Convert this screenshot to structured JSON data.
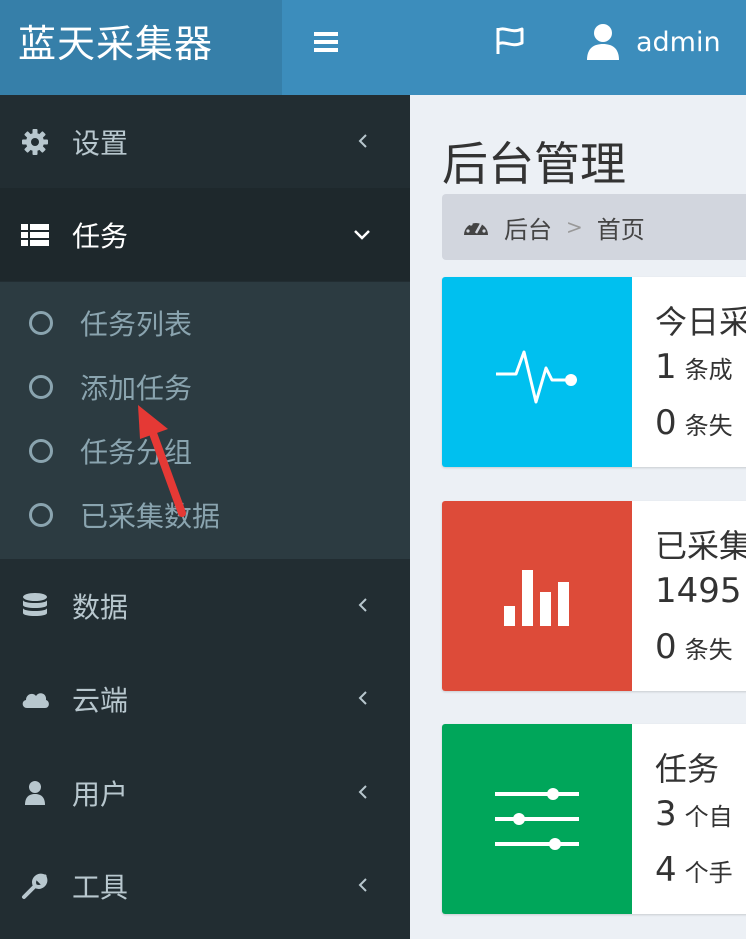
{
  "header": {
    "logo": "蓝天采集器",
    "username": "admin",
    "colors": {
      "bar": "#3c8dbc",
      "logo_bg": "#367fa9"
    }
  },
  "sidebar": {
    "items": [
      {
        "label": "设置",
        "icon": "gear-icon",
        "state": "collapsed"
      },
      {
        "label": "任务",
        "icon": "list-icon",
        "state": "expanded"
      },
      {
        "label": "数据",
        "icon": "database-icon",
        "state": "collapsed"
      },
      {
        "label": "云端",
        "icon": "cloud-icon",
        "state": "collapsed"
      },
      {
        "label": "用户",
        "icon": "user-icon",
        "state": "collapsed"
      },
      {
        "label": "工具",
        "icon": "wrench-icon",
        "state": "collapsed"
      }
    ],
    "submenu": [
      {
        "label": "任务列表"
      },
      {
        "label": "添加任务"
      },
      {
        "label": "任务分组"
      },
      {
        "label": "已采集数据"
      }
    ]
  },
  "main": {
    "title": "后台管理",
    "breadcrumb": {
      "root": "后台",
      "separator": ">",
      "current": "首页"
    },
    "infoboxes": [
      {
        "color": "#00c0ef",
        "icon": "pulse-icon",
        "title": "今日采",
        "line1_num": "1",
        "line1_text": "条成",
        "line2_num": "0",
        "line2_text": "条失"
      },
      {
        "color": "#dd4b39",
        "icon": "bar-chart-icon",
        "title": "已采集",
        "line1_num": "1495",
        "line1_text": "",
        "line2_num": "0",
        "line2_text": "条失"
      },
      {
        "color": "#00a65a",
        "icon": "sliders-icon",
        "title": "任务",
        "line1_num": "3",
        "line1_text": "个自",
        "line2_num": "4",
        "line2_text": "个手"
      }
    ]
  },
  "annotation": {
    "color": "#e53935"
  }
}
